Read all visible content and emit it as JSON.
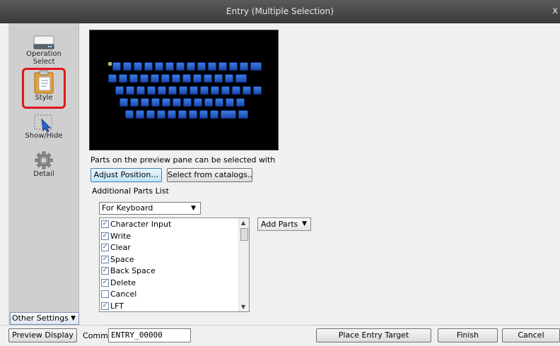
{
  "window": {
    "title": "Entry (Multiple Selection)",
    "close_glyph": "x"
  },
  "sidebar": {
    "items": [
      {
        "label_1": "Operation",
        "label_2": "Select"
      },
      {
        "label_1": "Style"
      },
      {
        "label_1": "Show/Hide"
      },
      {
        "label_1": "Detail"
      }
    ],
    "other_settings": "Other Settings"
  },
  "main": {
    "hint": "Parts on the preview pane can be selected with",
    "adjust_position": "Adjust Position…",
    "select_catalogs": "Select from catalogs…",
    "additional_parts_label": "Additional Parts List",
    "parts_category": "For Keyboard",
    "add_parts": "Add Parts",
    "parts_list": [
      {
        "label": "Character Input",
        "checked": true
      },
      {
        "label": "Write",
        "checked": true
      },
      {
        "label": "Clear",
        "checked": true
      },
      {
        "label": "Space",
        "checked": true
      },
      {
        "label": "Back Space",
        "checked": true
      },
      {
        "label": "Delete",
        "checked": true
      },
      {
        "label": "Cancel",
        "checked": false
      },
      {
        "label": "LFT",
        "checked": true
      }
    ]
  },
  "bottom": {
    "preview_display": "Preview Display",
    "comm_label": "Comm",
    "comm_value": "ENTRY_00000",
    "place_entry_target": "Place Entry Target",
    "finish": "Finish",
    "cancel": "Cancel"
  },
  "colors": {
    "titlebar": "#484848",
    "highlight_ring": "#e2161a",
    "key_blue": "#2a64cf"
  }
}
